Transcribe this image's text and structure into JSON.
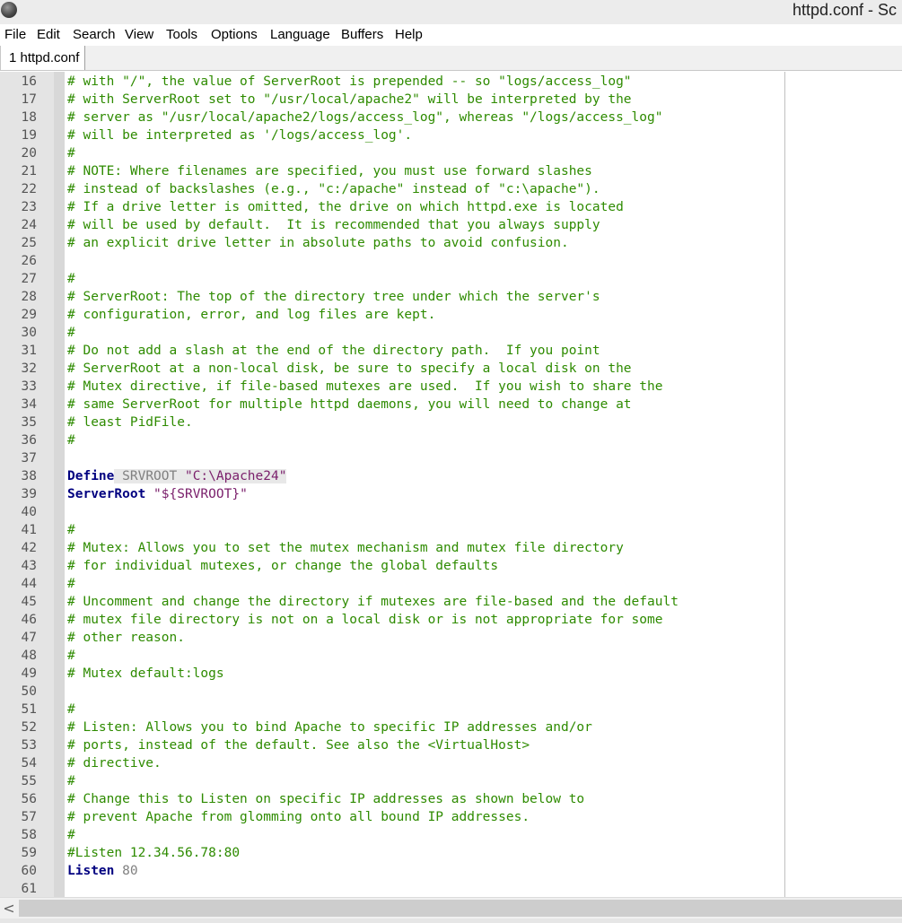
{
  "window": {
    "title": "httpd.conf - Sc"
  },
  "menu": [
    {
      "label": "File"
    },
    {
      "label": "Edit"
    },
    {
      "label": "Search"
    },
    {
      "label": "View"
    },
    {
      "label": "Tools"
    },
    {
      "label": "Options"
    },
    {
      "label": "Language"
    },
    {
      "label": "Buffers"
    },
    {
      "label": "Help"
    }
  ],
  "tabs": [
    {
      "label": "1 httpd.conf"
    }
  ],
  "scrollbar": {
    "left_arrow": "<"
  },
  "colors": {
    "comment": "#2e8b00",
    "keyword": "#000080",
    "string": "#7a1f6b",
    "identifier": "#808080",
    "gutter": "#e4e4e4"
  },
  "editor": {
    "lines": [
      {
        "no": "16",
        "parts": [
          {
            "t": "# with \"/\", the value of ServerRoot is prepended -- so \"logs/access_log\"",
            "c": "comment"
          }
        ]
      },
      {
        "no": "17",
        "parts": [
          {
            "t": "# with ServerRoot set to \"/usr/local/apache2\" will be interpreted by the",
            "c": "comment"
          }
        ]
      },
      {
        "no": "18",
        "parts": [
          {
            "t": "# server as \"/usr/local/apache2/logs/access_log\", whereas \"/logs/access_log\"",
            "c": "comment"
          }
        ]
      },
      {
        "no": "19",
        "parts": [
          {
            "t": "# will be interpreted as '/logs/access_log'.",
            "c": "comment"
          }
        ]
      },
      {
        "no": "20",
        "parts": [
          {
            "t": "#",
            "c": "comment"
          }
        ]
      },
      {
        "no": "21",
        "parts": [
          {
            "t": "# NOTE: Where filenames are specified, you must use forward slashes",
            "c": "comment"
          }
        ]
      },
      {
        "no": "22",
        "parts": [
          {
            "t": "# instead of backslashes (e.g., \"c:/apache\" instead of \"c:\\apache\").",
            "c": "comment"
          }
        ]
      },
      {
        "no": "23",
        "parts": [
          {
            "t": "# If a drive letter is omitted, the drive on which httpd.exe is located",
            "c": "comment"
          }
        ]
      },
      {
        "no": "24",
        "parts": [
          {
            "t": "# will be used by default.  It is recommended that you always supply",
            "c": "comment"
          }
        ]
      },
      {
        "no": "25",
        "parts": [
          {
            "t": "# an explicit drive letter in absolute paths to avoid confusion.",
            "c": "comment"
          }
        ]
      },
      {
        "no": "26",
        "parts": []
      },
      {
        "no": "27",
        "parts": [
          {
            "t": "#",
            "c": "comment"
          }
        ]
      },
      {
        "no": "28",
        "parts": [
          {
            "t": "# ServerRoot: The top of the directory tree under which the server's",
            "c": "comment"
          }
        ]
      },
      {
        "no": "29",
        "parts": [
          {
            "t": "# configuration, error, and log files are kept.",
            "c": "comment"
          }
        ]
      },
      {
        "no": "30",
        "parts": [
          {
            "t": "#",
            "c": "comment"
          }
        ]
      },
      {
        "no": "31",
        "parts": [
          {
            "t": "# Do not add a slash at the end of the directory path.  If you point",
            "c": "comment"
          }
        ]
      },
      {
        "no": "32",
        "parts": [
          {
            "t": "# ServerRoot at a non-local disk, be sure to specify a local disk on the",
            "c": "comment"
          }
        ]
      },
      {
        "no": "33",
        "parts": [
          {
            "t": "# Mutex directive, if file-based mutexes are used.  If you wish to share the",
            "c": "comment"
          }
        ]
      },
      {
        "no": "34",
        "parts": [
          {
            "t": "# same ServerRoot for multiple httpd daemons, you will need to change at",
            "c": "comment"
          }
        ]
      },
      {
        "no": "35",
        "parts": [
          {
            "t": "# least PidFile.",
            "c": "comment"
          }
        ]
      },
      {
        "no": "36",
        "parts": [
          {
            "t": "#",
            "c": "comment"
          }
        ]
      },
      {
        "no": "37",
        "parts": []
      },
      {
        "no": "38",
        "parts": [
          {
            "t": "Define",
            "c": "keyword"
          },
          {
            "t": " ",
            "c": "plain",
            "hl": true
          },
          {
            "t": "SRVROOT",
            "c": "ident",
            "hl": true
          },
          {
            "t": " ",
            "c": "plain",
            "hl": true
          },
          {
            "t": "\"C:\\Apache24\"",
            "c": "string",
            "hl": true
          }
        ]
      },
      {
        "no": "39",
        "parts": [
          {
            "t": "ServerRoot",
            "c": "keyword"
          },
          {
            "t": " ",
            "c": "plain"
          },
          {
            "t": "\"${SRVROOT}\"",
            "c": "string"
          }
        ]
      },
      {
        "no": "40",
        "parts": []
      },
      {
        "no": "41",
        "parts": [
          {
            "t": "#",
            "c": "comment"
          }
        ]
      },
      {
        "no": "42",
        "parts": [
          {
            "t": "# Mutex: Allows you to set the mutex mechanism and mutex file directory",
            "c": "comment"
          }
        ]
      },
      {
        "no": "43",
        "parts": [
          {
            "t": "# for individual mutexes, or change the global defaults",
            "c": "comment"
          }
        ]
      },
      {
        "no": "44",
        "parts": [
          {
            "t": "#",
            "c": "comment"
          }
        ]
      },
      {
        "no": "45",
        "parts": [
          {
            "t": "# Uncomment and change the directory if mutexes are file-based and the default",
            "c": "comment"
          }
        ]
      },
      {
        "no": "46",
        "parts": [
          {
            "t": "# mutex file directory is not on a local disk or is not appropriate for some",
            "c": "comment"
          }
        ]
      },
      {
        "no": "47",
        "parts": [
          {
            "t": "# other reason.",
            "c": "comment"
          }
        ]
      },
      {
        "no": "48",
        "parts": [
          {
            "t": "#",
            "c": "comment"
          }
        ]
      },
      {
        "no": "49",
        "parts": [
          {
            "t": "# Mutex default:logs",
            "c": "comment"
          }
        ]
      },
      {
        "no": "50",
        "parts": []
      },
      {
        "no": "51",
        "parts": [
          {
            "t": "#",
            "c": "comment"
          }
        ]
      },
      {
        "no": "52",
        "parts": [
          {
            "t": "# Listen: Allows you to bind Apache to specific IP addresses and/or",
            "c": "comment"
          }
        ]
      },
      {
        "no": "53",
        "parts": [
          {
            "t": "# ports, instead of the default. See also the <VirtualHost>",
            "c": "comment"
          }
        ]
      },
      {
        "no": "54",
        "parts": [
          {
            "t": "# directive.",
            "c": "comment"
          }
        ]
      },
      {
        "no": "55",
        "parts": [
          {
            "t": "#",
            "c": "comment"
          }
        ]
      },
      {
        "no": "56",
        "parts": [
          {
            "t": "# Change this to Listen on specific IP addresses as shown below to",
            "c": "comment"
          }
        ]
      },
      {
        "no": "57",
        "parts": [
          {
            "t": "# prevent Apache from glomming onto all bound IP addresses.",
            "c": "comment"
          }
        ]
      },
      {
        "no": "58",
        "parts": [
          {
            "t": "#",
            "c": "comment"
          }
        ]
      },
      {
        "no": "59",
        "parts": [
          {
            "t": "#Listen 12.34.56.78:80",
            "c": "comment"
          }
        ]
      },
      {
        "no": "60",
        "parts": [
          {
            "t": "Listen",
            "c": "keyword"
          },
          {
            "t": " ",
            "c": "plain"
          },
          {
            "t": "80",
            "c": "number"
          }
        ]
      },
      {
        "no": "61",
        "parts": []
      }
    ]
  }
}
